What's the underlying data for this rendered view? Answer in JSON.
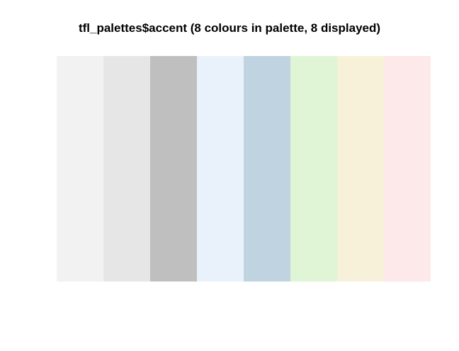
{
  "title": "tfl_palettes$accent (8 colours in palette, 8 displayed)",
  "palette": {
    "name": "accent",
    "colours": [
      {
        "name": "swatch-1",
        "hex": "#f2f2f2"
      },
      {
        "name": "swatch-2",
        "hex": "#e6e6e6"
      },
      {
        "name": "swatch-3",
        "hex": "#bfbfbf"
      },
      {
        "name": "swatch-4",
        "hex": "#e9f2fb"
      },
      {
        "name": "swatch-5",
        "hex": "#c0d3e1"
      },
      {
        "name": "swatch-6",
        "hex": "#e0f4d6"
      },
      {
        "name": "swatch-7",
        "hex": "#f7f1da"
      },
      {
        "name": "swatch-8",
        "hex": "#fde8ea"
      }
    ]
  }
}
